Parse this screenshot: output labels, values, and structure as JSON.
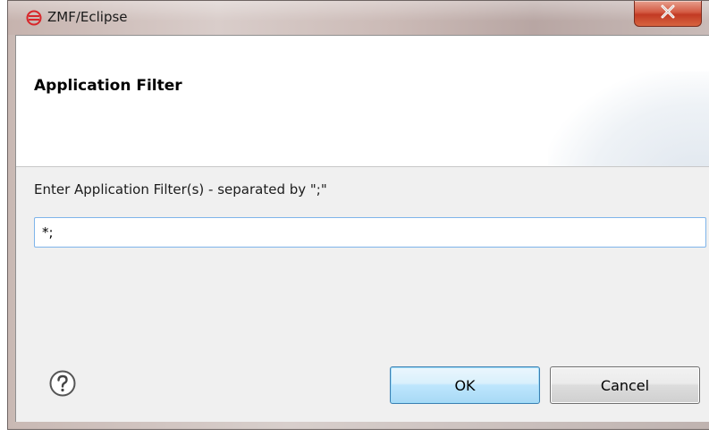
{
  "window": {
    "title": "ZMF/Eclipse",
    "app_icon": "zmf-logo-icon",
    "close_icon": "close-icon",
    "close_glyph": "x"
  },
  "banner": {
    "title": "Application Filter"
  },
  "form": {
    "label": "Enter Application Filter(s) - separated by \";\"",
    "filter_value": "*;"
  },
  "footer": {
    "help_icon": "help-icon",
    "ok_label": "OK",
    "cancel_label": "Cancel"
  },
  "colors": {
    "close_button": "#c9452c",
    "ok_border": "#3c7fb1",
    "input_border": "#7eb4ea",
    "app_icon": "#d8262a"
  }
}
